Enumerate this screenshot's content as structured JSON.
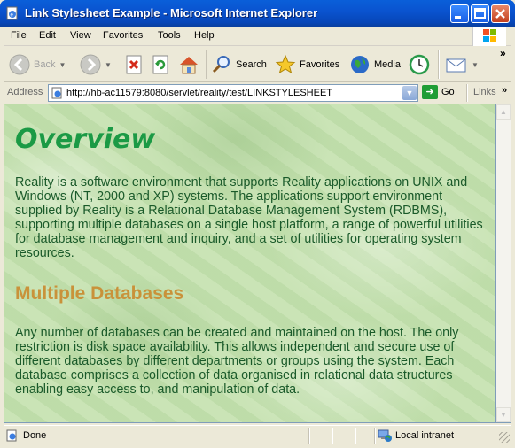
{
  "window": {
    "title": "Link Stylesheet Example - Microsoft Internet Explorer"
  },
  "menu": [
    "File",
    "Edit",
    "View",
    "Favorites",
    "Tools",
    "Help"
  ],
  "toolbar": {
    "back_label": "Back",
    "search_label": "Search",
    "favorites_label": "Favorites",
    "media_label": "Media"
  },
  "address": {
    "label": "Address",
    "url": "http://hb-ac11579:8080/servlet/reality/test/LINKSTYLESHEET",
    "go_label": "Go",
    "links_label": "Links"
  },
  "page": {
    "heading": "Overview",
    "paragraph1": "Reality is a software environment that supports Reality applications on UNIX and Windows (NT, 2000 and XP) systems. The applications support environment supplied by Reality is a Relational Database Management System (RDBMS), supporting multiple databases on a single host platform, a range of powerful utilities for database management and inquiry, and a set of utilities for operating system resources.",
    "subheading": "Multiple Databases",
    "paragraph2": "Any number of databases can be created and maintained on the host. The only restriction is disk space availability. This allows independent and secure use of different databases by different departments or groups using the system. Each database comprises a collection of data organised in relational data structures enabling easy access to, and manipulation of data."
  },
  "status": {
    "text": "Done",
    "zone": "Local intranet"
  },
  "colors": {
    "heading": "#1b9a45",
    "subheading": "#c9923a",
    "body_text": "#1a5a2a",
    "page_background": "#c6e2b0",
    "titlebar": "#0a54d0"
  }
}
